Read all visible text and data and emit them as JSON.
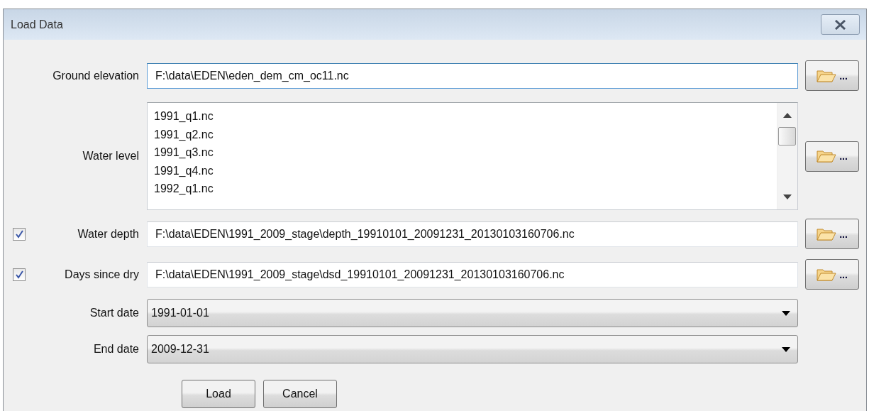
{
  "window": {
    "title": "Load Data"
  },
  "rows": [
    {
      "kind": "path",
      "label": "Ground elevation",
      "value": "F:\\data\\EDEN\\eden_dem_cm_oc11.nc",
      "focused": true,
      "browse": "..."
    },
    {
      "kind": "list",
      "label": "Water level",
      "items": [
        "1991_q1.nc",
        "1991_q2.nc",
        "1991_q3.nc",
        "1991_q4.nc",
        "1992_q1.nc"
      ],
      "browse": "..."
    },
    {
      "kind": "path",
      "label": "Water depth",
      "checked": true,
      "focused": false,
      "value": "F:\\data\\EDEN\\1991_2009_stage\\depth_19910101_20091231_20130103160706.nc",
      "browse": "..."
    },
    {
      "kind": "path",
      "label": "Days since dry",
      "checked": true,
      "focused": false,
      "value": "F:\\data\\EDEN\\1991_2009_stage\\dsd_19910101_20091231_20130103160706.nc",
      "browse": "..."
    },
    {
      "kind": "combo",
      "label": "Start date",
      "value": "1991-01-01"
    },
    {
      "kind": "combo",
      "label": "End date",
      "value": "2009-12-31"
    }
  ],
  "buttons": [
    "Load",
    "Cancel"
  ]
}
